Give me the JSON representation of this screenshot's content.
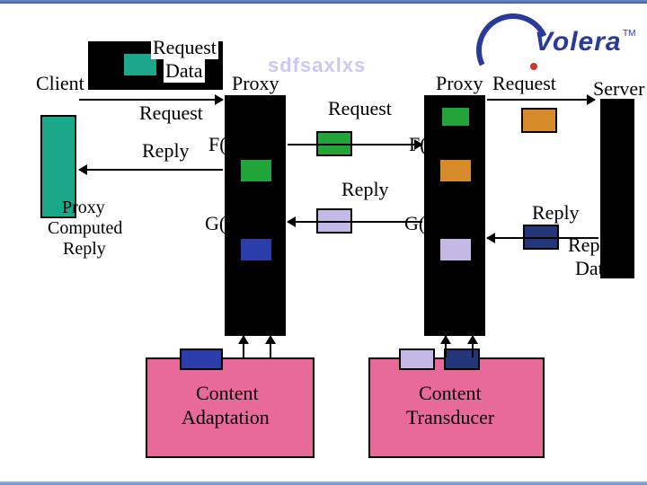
{
  "logo": {
    "name": "Volera",
    "tm": "TM"
  },
  "faint_title": "sdfsaxlxs",
  "labels": {
    "client": "Client",
    "server": "Server",
    "proxy_left": "Proxy",
    "proxy_right": "Proxy",
    "request_data1": "Request",
    "request_data2": "Data",
    "request_below": "Request",
    "request_mid": "Request",
    "request_right": "Request",
    "reply_left": "Reply",
    "reply_mid": "Reply",
    "reply_right": "Reply",
    "reply_data1": "Reply",
    "reply_data2": "Data",
    "proxy_computed1": "Proxy",
    "proxy_computed2": "Computed",
    "proxy_computed3": "Reply",
    "freq_l": "F(req)=",
    "freq_r": "F(req)=",
    "grep_l": "G(rep)=",
    "grep_r": "G(rep)=",
    "content_adapt1": "Content",
    "content_adapt2": "Adaptation",
    "content_trans1": "Content",
    "content_trans2": "Transducer"
  },
  "colors": {
    "teal": "#1aa78a",
    "green": "#22a43a",
    "orange": "#d68a2a",
    "blue": "#2a3da8",
    "lav": "#c3b8e6",
    "navy": "#23367a",
    "black": "#000"
  }
}
